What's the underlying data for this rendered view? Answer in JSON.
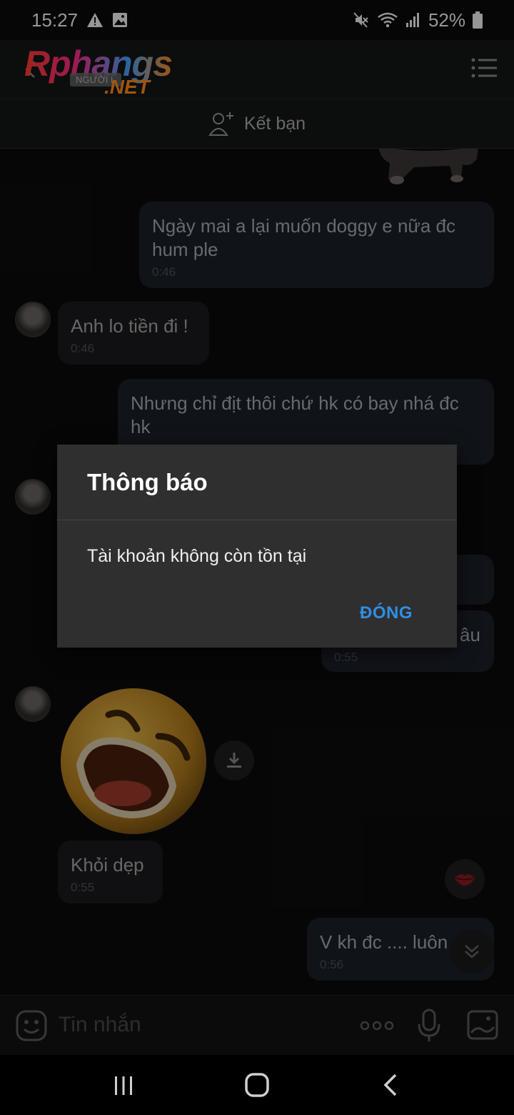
{
  "status_bar": {
    "time": "15:27",
    "battery": "52%"
  },
  "header": {
    "logo_main": "Rphangs",
    "logo_sub": ".NET",
    "logo_badge": "NGƯỜI L",
    "friend_button_label": "Kết bạn"
  },
  "messages": [
    {
      "side": "me",
      "text": "Ngày mai a lại muốn doggy e nữa đc hum ple",
      "time": "0:46"
    },
    {
      "side": "them",
      "text": "Anh lo tiền đi !",
      "time": "0:46"
    },
    {
      "side": "me",
      "text": "Nhưng chỉ địt thôi chứ hk có bay nhá đc hk",
      "time": ""
    },
    {
      "side": "me",
      "text": "âu",
      "time": "0:55"
    },
    {
      "side": "them",
      "text": "Khỏi dẹp",
      "time": "0:55"
    },
    {
      "side": "me",
      "text": "V kh đc .... luôn",
      "time": "0:56"
    }
  ],
  "dialog": {
    "title": "Thông báo",
    "message": "Tài khoản không còn tồn tại",
    "close_label": "ĐÓNG"
  },
  "input": {
    "placeholder": "Tin nhắn"
  },
  "colors": {
    "accent": "#2f8ee6",
    "dialog_bg": "#2f2f2f",
    "bubble_me": "#1b1f27"
  }
}
